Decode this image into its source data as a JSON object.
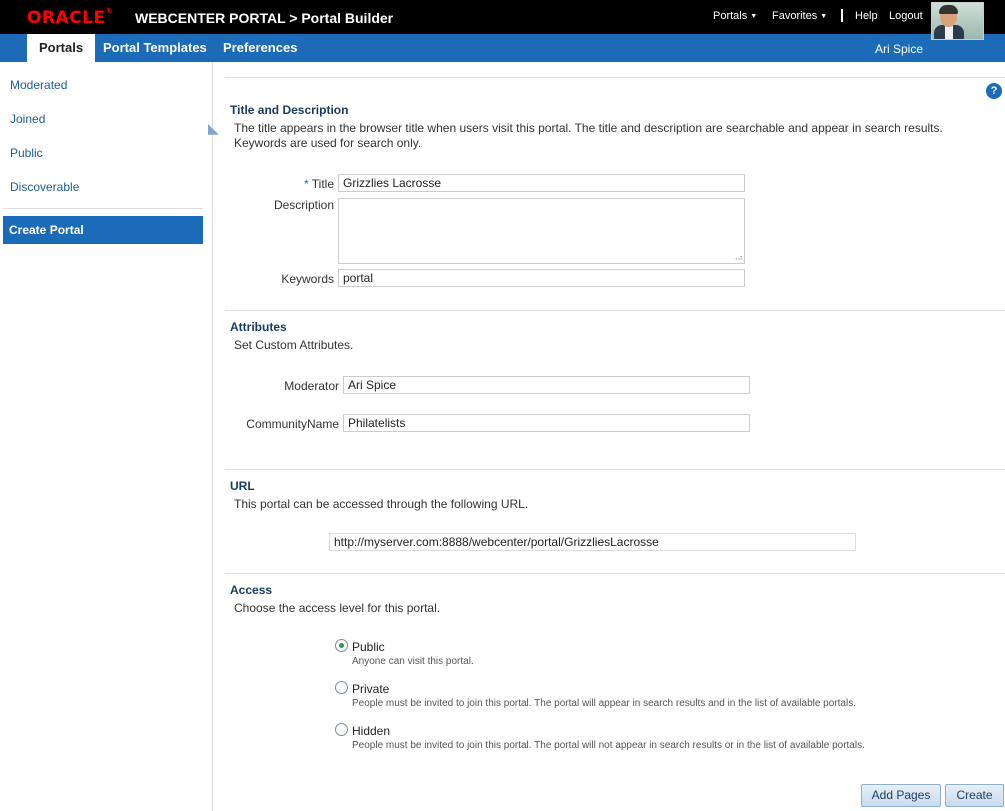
{
  "header": {
    "brand": "ORACLE",
    "app_title": "WEBCENTER PORTAL > Portal Builder",
    "menu_portals": "Portals",
    "menu_favorites": "Favorites",
    "link_help": "Help",
    "link_logout": "Logout"
  },
  "nav": {
    "tabs": [
      "Portals",
      "Portal Templates",
      "Preferences"
    ],
    "user": "Ari Spice"
  },
  "sidebar": {
    "items": [
      "Moderated",
      "Joined",
      "Public",
      "Discoverable"
    ],
    "create": "Create Portal"
  },
  "title_section": {
    "heading": "Title and Description",
    "desc_line1": "The title appears in the browser title when users visit this portal. The title and description are searchable and appear in search results.",
    "desc_line2": "Keywords are used for search only.",
    "title_required": "*",
    "title_label": "Title",
    "title_value": "Grizzlies Lacrosse",
    "description_label": "Description",
    "description_value": "",
    "keywords_label": "Keywords",
    "keywords_value": "portal"
  },
  "attributes": {
    "heading": "Attributes",
    "desc": "Set Custom Attributes.",
    "moderator_label": "Moderator",
    "moderator_value": "Ari Spice",
    "community_label": "CommunityName",
    "community_value": "Philatelists"
  },
  "url_section": {
    "heading": "URL",
    "desc": "This portal can be accessed through the following URL.",
    "url": "http://myserver.com:8888/webcenter/portal/GrizzliesLacrosse"
  },
  "access": {
    "heading": "Access",
    "desc": "Choose the access level for this portal.",
    "selected": "Public",
    "options": [
      {
        "label": "Public",
        "help": "Anyone can visit this portal."
      },
      {
        "label": "Private",
        "help": "People must be invited to join this portal. The portal will appear in search results and in the list of available portals."
      },
      {
        "label": "Hidden",
        "help": "People must be invited to join this portal. The portal will not appear in search results or in the list of available portals."
      }
    ]
  },
  "buttons": {
    "add_pages": "Add Pages",
    "create": "Create"
  },
  "colors": {
    "nav_blue": "#1b6bb9",
    "oracle_red": "#ff0000",
    "heading_navy": "#163b5e"
  }
}
